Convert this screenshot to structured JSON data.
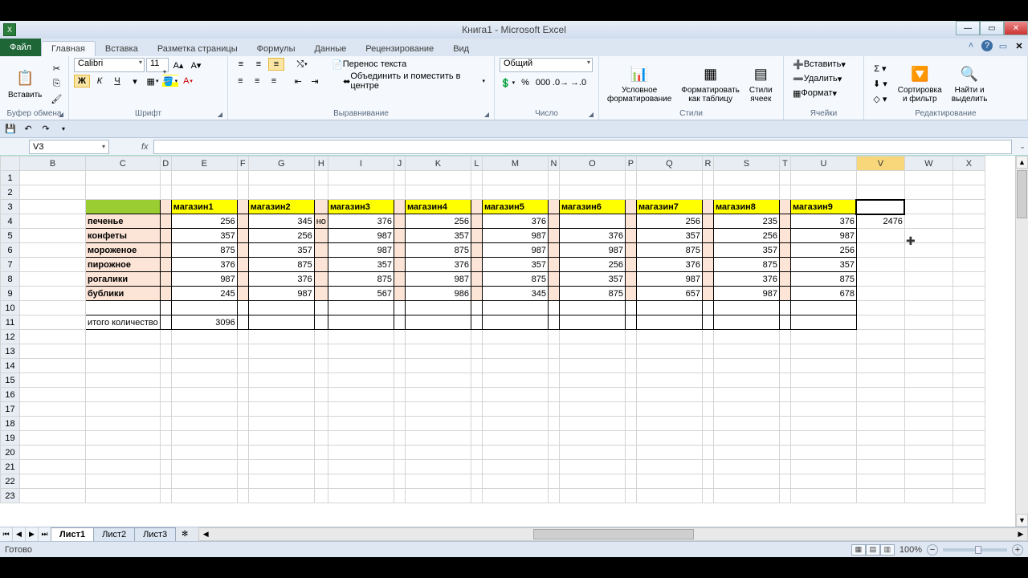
{
  "title": "Книга1 - Microsoft Excel",
  "tabs": {
    "file": "Файл",
    "home": "Главная",
    "insert": "Вставка",
    "layout": "Разметка страницы",
    "formulas": "Формулы",
    "data": "Данные",
    "review": "Рецензирование",
    "view": "Вид"
  },
  "ribbon": {
    "clipboard": {
      "paste": "Вставить",
      "label": "Буфер обмена"
    },
    "font": {
      "name": "Calibri",
      "size": "11",
      "label": "Шрифт"
    },
    "alignment": {
      "wrap": "Перенос текста",
      "merge": "Объединить и поместить в центре",
      "label": "Выравнивание"
    },
    "number": {
      "format": "Общий",
      "pct": "%",
      "thousands": "000",
      "label": "Число"
    },
    "styles": {
      "cond": "Условное\nформатирование",
      "table": "Форматировать\nкак таблицу",
      "cell": "Стили\nячеек",
      "label": "Стили"
    },
    "cells": {
      "insert": "Вставить",
      "delete": "Удалить",
      "format": "Формат",
      "label": "Ячейки"
    },
    "editing": {
      "sort": "Сортировка\nи фильтр",
      "find": "Найти и\nвыделить",
      "label": "Редактирование"
    }
  },
  "name_box": "V3",
  "columns": [
    "B",
    "C",
    "D",
    "E",
    "F",
    "G",
    "H",
    "I",
    "J",
    "K",
    "L",
    "M",
    "N",
    "O",
    "P",
    "Q",
    "R",
    "S",
    "T",
    "U",
    "V",
    "W",
    "X"
  ],
  "selected_col": "V",
  "rows_visible": 23,
  "table": {
    "header_cols": [
      "магазин1",
      "магазин2",
      "магазин3",
      "магазин4",
      "магазин5",
      "магазин6",
      "магазин7",
      "магазин8",
      "магазин9"
    ],
    "row_labels": [
      "печенье",
      "конфеты",
      "мороженое",
      "пирожное",
      "рогалики",
      "бублики"
    ],
    "extra": {
      "H4": "но"
    },
    "data": [
      [
        256,
        345,
        376,
        256,
        376,
        null,
        256,
        235,
        376
      ],
      [
        357,
        256,
        987,
        357,
        987,
        376,
        357,
        256,
        987
      ],
      [
        875,
        357,
        987,
        875,
        987,
        987,
        875,
        357,
        256
      ],
      [
        376,
        875,
        357,
        376,
        357,
        256,
        376,
        875,
        357
      ],
      [
        987,
        376,
        875,
        987,
        875,
        357,
        987,
        376,
        875
      ],
      [
        245,
        987,
        567,
        986,
        345,
        875,
        657,
        987,
        678
      ]
    ],
    "v4": 2476,
    "total_label": "итого количество",
    "total_value": 3096
  },
  "sheets": [
    "Лист1",
    "Лист2",
    "Лист3"
  ],
  "status": {
    "ready": "Готово",
    "zoom": "100%"
  }
}
